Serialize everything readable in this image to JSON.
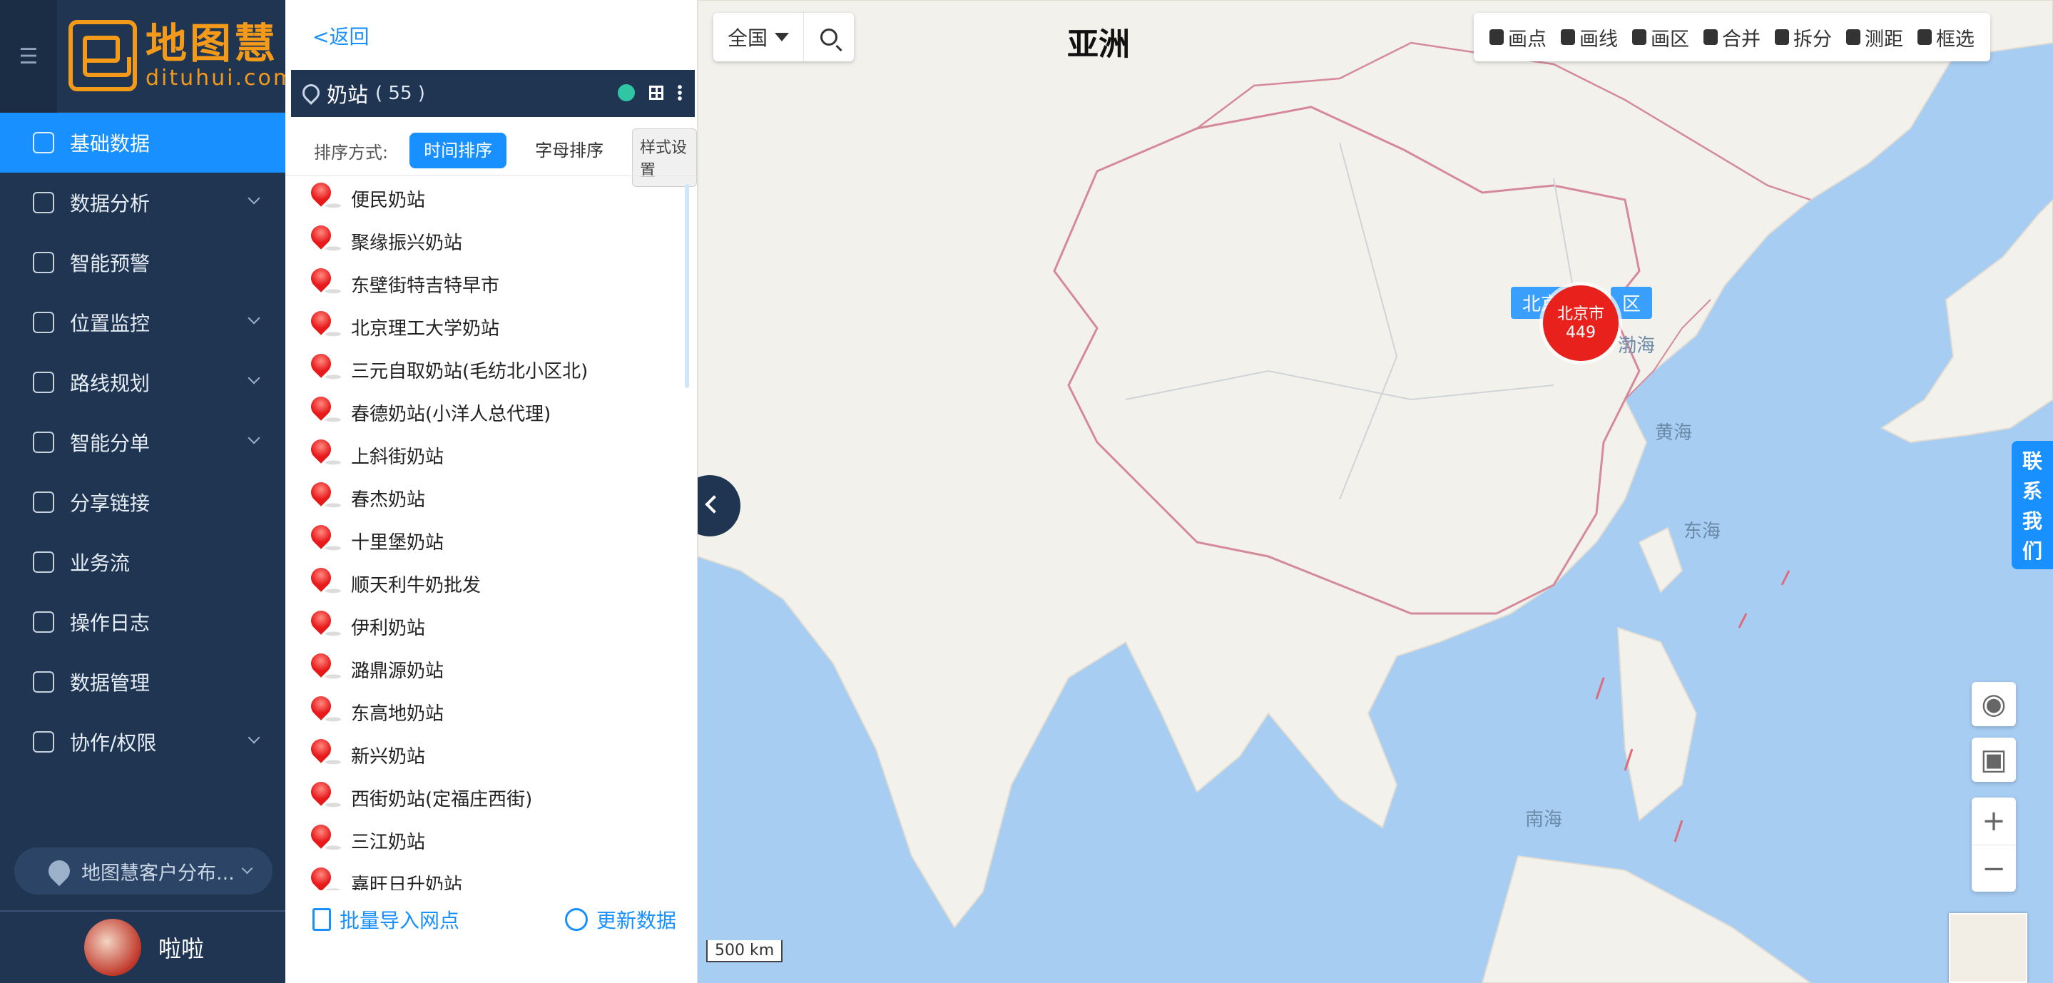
{
  "nav": {
    "logo_cn": "地图慧",
    "logo_en": "dituhui.com",
    "items": [
      {
        "label": "基础数据",
        "active": true,
        "has_sub": false
      },
      {
        "label": "数据分析",
        "active": false,
        "has_sub": true
      },
      {
        "label": "智能预警",
        "active": false,
        "has_sub": false
      },
      {
        "label": "位置监控",
        "active": false,
        "has_sub": true
      },
      {
        "label": "路线规划",
        "active": false,
        "has_sub": true
      },
      {
        "label": "智能分单",
        "active": false,
        "has_sub": true
      },
      {
        "label": "分享链接",
        "active": false,
        "has_sub": false
      },
      {
        "label": "业务流",
        "active": false,
        "has_sub": false
      },
      {
        "label": "操作日志",
        "active": false,
        "has_sub": false
      },
      {
        "label": "数据管理",
        "active": false,
        "has_sub": false
      },
      {
        "label": "协作/权限",
        "active": false,
        "has_sub": true
      }
    ],
    "project": "地图慧客户分布...",
    "user": "啦啦"
  },
  "panel": {
    "back": "<返回",
    "layer_name": "奶站",
    "layer_count": "( 55 )",
    "sort_label": "排序方式:",
    "sort_time": "时间排序",
    "sort_alpha": "字母排序",
    "tooltip": "样式设置",
    "items": [
      "便民奶站",
      "聚缘振兴奶站",
      "东壁街特吉特早市",
      "北京理工大学奶站",
      "三元自取奶站(毛纺北小区北)",
      "春德奶站(小洋人总代理)",
      "上斜街奶站",
      "春杰奶站",
      "十里堡奶站",
      "顺天利牛奶批发",
      "伊利奶站",
      "潞鼎源奶站",
      "东高地奶站",
      "新兴奶站",
      "西街奶站(定福庄西街)",
      "三江奶站",
      "嘉旺日升奶站"
    ],
    "import": "批量导入网点",
    "update": "更新数据"
  },
  "map": {
    "region": "全国",
    "continent": "亚洲",
    "tools": [
      "画点",
      "画线",
      "画区",
      "合并",
      "拆分",
      "测距",
      "框选"
    ],
    "cluster_name": "北京市",
    "cluster_count": "449",
    "label_a": "北京",
    "label_b": "区",
    "seas": [
      "渤海",
      "黄海",
      "东海",
      "南海"
    ],
    "scale": "500 km",
    "contact": [
      "联",
      "系",
      "我",
      "们"
    ],
    "colors": {
      "accent": "#1890ff",
      "nav_bg": "#1f3552",
      "cluster": "#e8211d",
      "logo": "#f39a1a"
    }
  }
}
